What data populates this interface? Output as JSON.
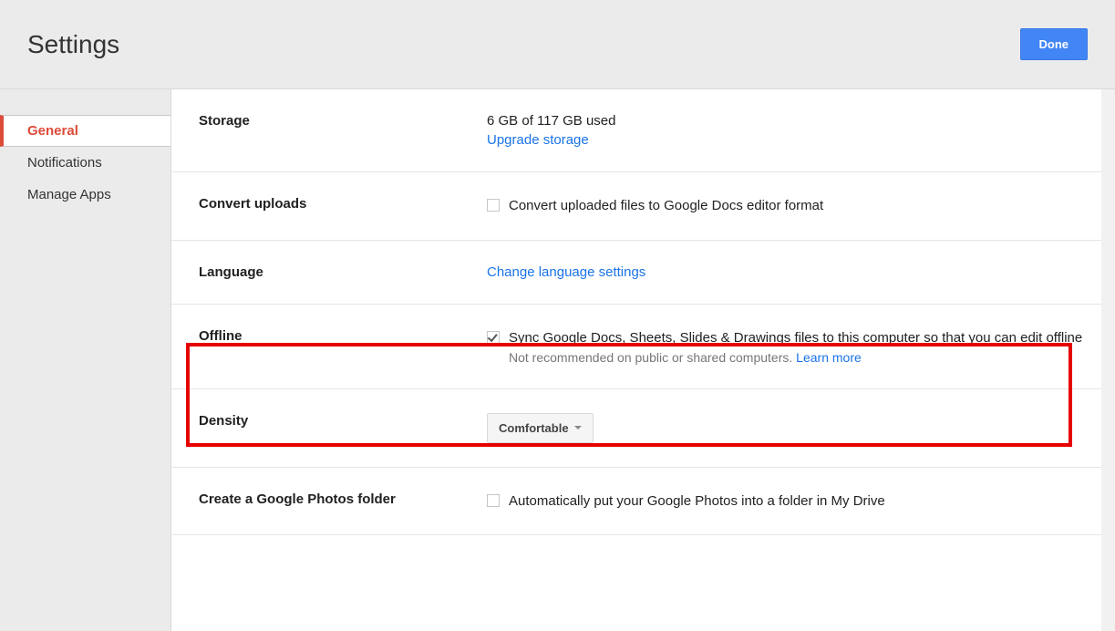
{
  "header": {
    "title": "Settings",
    "done_label": "Done"
  },
  "sidebar": {
    "items": [
      {
        "label": "General",
        "active": true
      },
      {
        "label": "Notifications",
        "active": false
      },
      {
        "label": "Manage Apps",
        "active": false
      }
    ]
  },
  "settings": {
    "storage": {
      "label": "Storage",
      "usage_text": "6 GB of 117 GB used",
      "upgrade_link": "Upgrade storage"
    },
    "convert_uploads": {
      "label": "Convert uploads",
      "checkbox_text": "Convert uploaded files to Google Docs editor format",
      "checked": false
    },
    "language": {
      "label": "Language",
      "link_text": "Change language settings"
    },
    "offline": {
      "label": "Offline",
      "checkbox_text": "Sync Google Docs, Sheets, Slides & Drawings files to this computer so that you can edit offline",
      "helper_text": "Not recommended on public or shared computers. ",
      "learn_more": "Learn more",
      "checked": true
    },
    "density": {
      "label": "Density",
      "dropdown_value": "Comfortable"
    },
    "photos_folder": {
      "label": "Create a Google Photos folder",
      "checkbox_text": "Automatically put your Google Photos into a folder in My Drive",
      "checked": false
    }
  }
}
